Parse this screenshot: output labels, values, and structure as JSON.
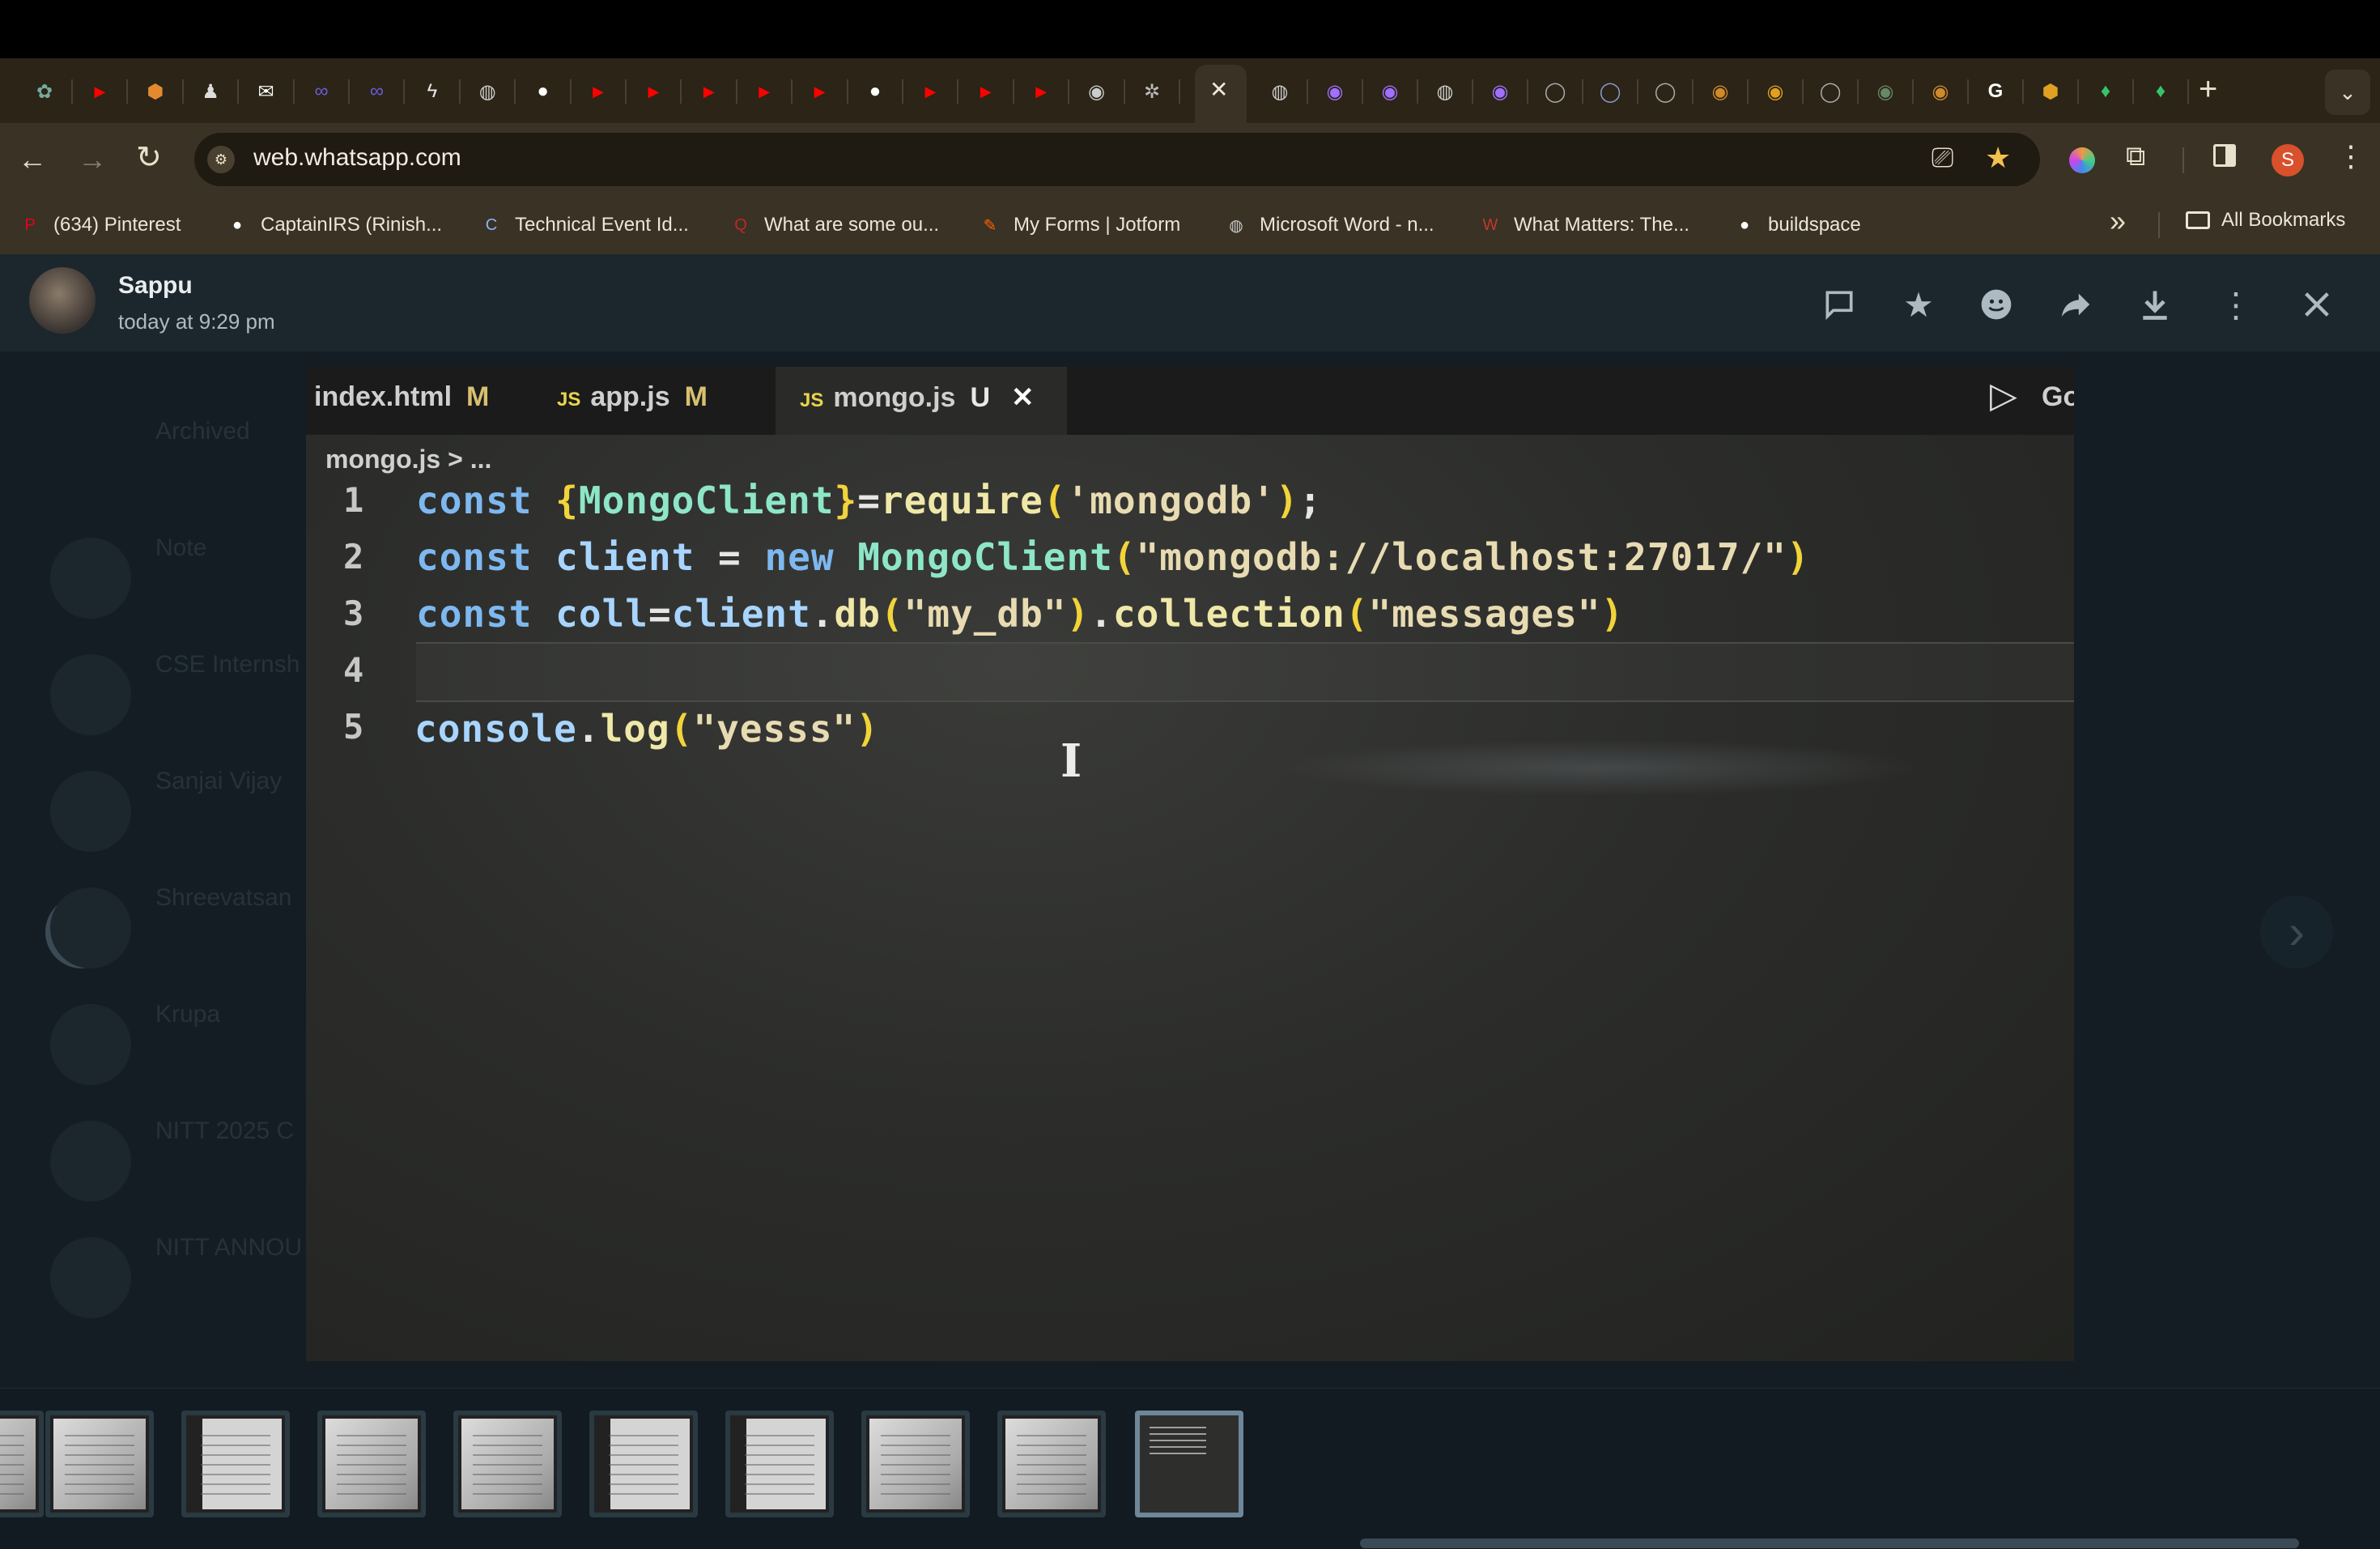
{
  "browser": {
    "url": "web.whatsapp.com",
    "tabs": [
      {
        "icon": "chatgpt-icon",
        "color": "#74aa9c"
      },
      {
        "icon": "youtube-icon",
        "color": "#ff0000"
      },
      {
        "icon": "box-icon",
        "color": "#e38a2f"
      },
      {
        "icon": "person-icon",
        "color": "#dddddd"
      },
      {
        "icon": "chat-icon",
        "color": "#ffffff"
      },
      {
        "icon": "link-icon",
        "color": "#6b5bd6"
      },
      {
        "icon": "link-icon",
        "color": "#6b5bd6"
      },
      {
        "icon": "lightning-icon",
        "color": "#e8e8e8"
      },
      {
        "icon": "globe-icon",
        "color": "#cccccc"
      },
      {
        "icon": "github-icon",
        "color": "#ffffff"
      },
      {
        "icon": "youtube-icon",
        "color": "#ff0000"
      },
      {
        "icon": "youtube-icon",
        "color": "#ff0000"
      },
      {
        "icon": "youtube-icon",
        "color": "#ff0000"
      },
      {
        "icon": "youtube-icon",
        "color": "#ff0000"
      },
      {
        "icon": "youtube-icon",
        "color": "#ff0000"
      },
      {
        "icon": "github-icon",
        "color": "#ffffff"
      },
      {
        "icon": "youtube-icon",
        "color": "#ff0000"
      },
      {
        "icon": "youtube-icon",
        "color": "#ff0000"
      },
      {
        "icon": "youtube-icon",
        "color": "#ff0000"
      },
      {
        "icon": "circle-icon",
        "color": "#cccccc"
      },
      {
        "icon": "gear-icon",
        "color": "#bbbbbb"
      }
    ],
    "active_tab_close": "✕",
    "tabs_right": [
      {
        "icon": "globe-icon",
        "color": "#cccccc"
      },
      {
        "icon": "circle-icon",
        "color": "#a070ff"
      },
      {
        "icon": "circle-icon",
        "color": "#a070ff"
      },
      {
        "icon": "globe-icon",
        "color": "#cccccc"
      },
      {
        "icon": "circle-icon",
        "color": "#a070ff"
      },
      {
        "icon": "ring-icon",
        "color": "#aaaaaa"
      },
      {
        "icon": "ring-icon",
        "color": "#8899cc"
      },
      {
        "icon": "ring-icon",
        "color": "#aaaaaa"
      },
      {
        "icon": "circle-icon",
        "color": "#d08a2a"
      },
      {
        "icon": "circle-icon",
        "color": "#e0a020"
      },
      {
        "icon": "ring-icon",
        "color": "#aaaaaa"
      },
      {
        "icon": "circle-icon",
        "color": "#668866"
      },
      {
        "icon": "circle-icon",
        "color": "#d08a2a"
      },
      {
        "icon": "google-icon",
        "color": "#ffffff"
      },
      {
        "icon": "box-icon",
        "color": "#e0a020"
      },
      {
        "icon": "leaf-icon",
        "color": "#37c36a"
      },
      {
        "icon": "leaf-icon",
        "color": "#37c36a"
      }
    ],
    "new_tab": "+",
    "profile_initial": "S",
    "bookmarks": [
      {
        "label": "(634) Pinterest",
        "icon": "pinterest-icon",
        "color": "#e60023"
      },
      {
        "label": "CaptainIRS (Rinish...",
        "icon": "github-icon",
        "color": "#ffffff"
      },
      {
        "label": "Technical Event Id...",
        "icon": "cs-icon",
        "color": "#8ab4f8"
      },
      {
        "label": "What are some ou...",
        "icon": "quora-icon",
        "color": "#b92b27"
      },
      {
        "label": "My Forms | Jotform",
        "icon": "jotform-icon",
        "color": "#ff6100"
      },
      {
        "label": "Microsoft Word - n...",
        "icon": "globe-icon",
        "color": "#cccccc"
      },
      {
        "label": "What Matters: The...",
        "icon": "wm-icon",
        "color": "#c0392b"
      },
      {
        "label": "buildspace",
        "icon": "github-icon",
        "color": "#ffffff"
      }
    ],
    "bookmarks_overflow": "»",
    "all_bookmarks": "All Bookmarks"
  },
  "viewer": {
    "sender": "Sappu",
    "timestamp": "today at 9:29 pm",
    "actions": [
      "reply-icon",
      "star-icon",
      "emoji-icon",
      "forward-icon",
      "download-icon",
      "more-icon",
      "close-icon"
    ]
  },
  "background_chats": [
    {
      "name": "Archived",
      "sub": ""
    },
    {
      "name": "Note",
      "sub": ""
    },
    {
      "name": "CSE Internsh",
      "sub": ""
    },
    {
      "name": "Sanjai Vijay",
      "sub": ""
    },
    {
      "name": "Shreevatsan",
      "sub": ""
    },
    {
      "name": "Krupa",
      "sub": ""
    },
    {
      "name": "NITT 2025 C",
      "sub": ""
    },
    {
      "name": "NITT ANNOU",
      "sub": ""
    }
  ],
  "photo": {
    "editor_tabs": [
      {
        "label": "index.html",
        "suffix": "M",
        "js": false
      },
      {
        "label": "app.js",
        "suffix": "M",
        "js": true
      },
      {
        "label": "mongo.js",
        "suffix": "U",
        "js": true,
        "close": "✕"
      }
    ],
    "run_label": "Go",
    "breadcrumb": "mongo.js > ...",
    "line_numbers": [
      "1",
      "2",
      "3",
      "4",
      "5"
    ],
    "code": {
      "line1": {
        "kw": "const ",
        "brace_open": "{",
        "cls": "MongoClient",
        "brace_close": "}",
        "eq": "=",
        "fn": "require",
        "paren_open": "(",
        "str": "'mongodb'",
        "paren_close": ")",
        "semi": ";"
      },
      "line2": {
        "kw": "const ",
        "var": "client",
        "eq": " = ",
        "kw2": "new ",
        "cls": "MongoClient",
        "paren_open": "(",
        "str": "\"mongodb://localhost:27017/\"",
        "paren_close": ")"
      },
      "line3": {
        "kw": "const ",
        "var": "coll",
        "eq": "=",
        "obj": "client",
        "dot": ".",
        "fn": "db",
        "p1": "(",
        "str1": "\"my_db\"",
        "p2": ")",
        "dot2": ".",
        "fn2": "collection",
        "p3": "(",
        "str2": "\"messages\"",
        "p4": ")"
      },
      "line5": {
        "obj": "console",
        "dot": ".",
        "fn": "log",
        "p1": "(",
        "str": "\"yesss\"",
        "p2": ")"
      }
    }
  },
  "thumbnails_count": 10,
  "nav": {
    "prev": "‹",
    "next": "›"
  }
}
